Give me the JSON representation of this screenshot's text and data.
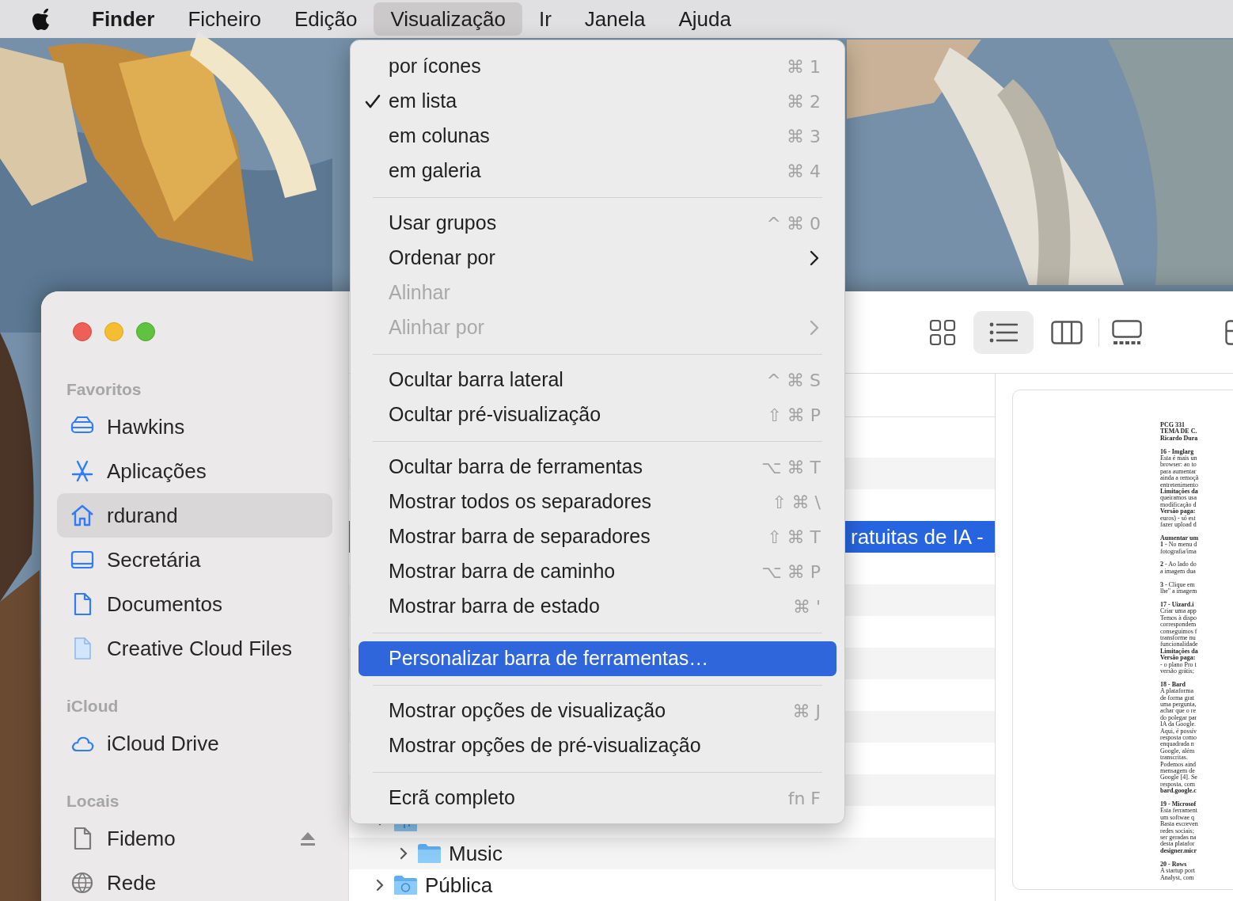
{
  "menu_bar": {
    "items": [
      {
        "label": "Finder",
        "kind": "app",
        "selected": false
      },
      {
        "label": "Ficheiro",
        "kind": "menu",
        "selected": false
      },
      {
        "label": "Edição",
        "kind": "menu",
        "selected": false
      },
      {
        "label": "Visualização",
        "kind": "menu",
        "selected": true
      },
      {
        "label": "Ir",
        "kind": "menu",
        "selected": false
      },
      {
        "label": "Janela",
        "kind": "menu",
        "selected": false
      },
      {
        "label": "Ajuda",
        "kind": "menu",
        "selected": false
      }
    ]
  },
  "view_menu": {
    "items": [
      {
        "kind": "item",
        "label": "por ícones",
        "shortcut": "⌘ 1",
        "checked": false,
        "disabled": false,
        "submenu": false,
        "selected": false
      },
      {
        "kind": "item",
        "label": "em lista",
        "shortcut": "⌘ 2",
        "checked": true,
        "disabled": false,
        "submenu": false,
        "selected": false
      },
      {
        "kind": "item",
        "label": "em colunas",
        "shortcut": "⌘ 3",
        "checked": false,
        "disabled": false,
        "submenu": false,
        "selected": false
      },
      {
        "kind": "item",
        "label": "em galeria",
        "shortcut": "⌘ 4",
        "checked": false,
        "disabled": false,
        "submenu": false,
        "selected": false
      },
      {
        "kind": "separator"
      },
      {
        "kind": "item",
        "label": "Usar grupos",
        "shortcut": "^ ⌘ 0",
        "checked": false,
        "disabled": false,
        "submenu": false,
        "selected": false
      },
      {
        "kind": "item",
        "label": "Ordenar por",
        "checked": false,
        "disabled": false,
        "submenu": true,
        "selected": false
      },
      {
        "kind": "item",
        "label": "Alinhar",
        "checked": false,
        "disabled": true,
        "submenu": false,
        "selected": false
      },
      {
        "kind": "item",
        "label": "Alinhar por",
        "checked": false,
        "disabled": true,
        "submenu": true,
        "selected": false
      },
      {
        "kind": "separator"
      },
      {
        "kind": "item",
        "label": "Ocultar barra lateral",
        "shortcut": "^ ⌘ S",
        "checked": false,
        "disabled": false,
        "submenu": false,
        "selected": false
      },
      {
        "kind": "item",
        "label": "Ocultar pré-visualização",
        "shortcut": "⇧ ⌘ P",
        "checked": false,
        "disabled": false,
        "submenu": false,
        "selected": false
      },
      {
        "kind": "separator"
      },
      {
        "kind": "item",
        "label": "Ocultar barra de ferramentas",
        "shortcut": "⌥ ⌘ T",
        "checked": false,
        "disabled": false,
        "submenu": false,
        "selected": false
      },
      {
        "kind": "item",
        "label": "Mostrar todos os separadores",
        "shortcut": "⇧ ⌘ \\",
        "checked": false,
        "disabled": false,
        "submenu": false,
        "selected": false
      },
      {
        "kind": "item",
        "label": "Mostrar barra de separadores",
        "shortcut": "⇧ ⌘ T",
        "checked": false,
        "disabled": false,
        "submenu": false,
        "selected": false
      },
      {
        "kind": "item",
        "label": "Mostrar barra de caminho",
        "shortcut": "⌥ ⌘ P",
        "checked": false,
        "disabled": false,
        "submenu": false,
        "selected": false
      },
      {
        "kind": "item",
        "label": "Mostrar barra de estado",
        "shortcut": "⌘ '",
        "checked": false,
        "disabled": false,
        "submenu": false,
        "selected": false
      },
      {
        "kind": "separator"
      },
      {
        "kind": "item",
        "label": "Personalizar barra de ferramentas…",
        "checked": false,
        "disabled": false,
        "submenu": false,
        "selected": true
      },
      {
        "kind": "separator"
      },
      {
        "kind": "item",
        "label": "Mostrar opções de visualização",
        "shortcut": "⌘ J",
        "checked": false,
        "disabled": false,
        "submenu": false,
        "selected": false
      },
      {
        "kind": "item",
        "label": "Mostrar opções de pré-visualização",
        "checked": false,
        "disabled": false,
        "submenu": false,
        "selected": false
      },
      {
        "kind": "separator"
      },
      {
        "kind": "item",
        "label": "Ecrã completo",
        "shortcut": "fn F",
        "checked": false,
        "disabled": false,
        "submenu": false,
        "selected": false
      }
    ]
  },
  "sidebar": {
    "sections": [
      {
        "title": "Favoritos",
        "items": [
          {
            "label": "Hawkins",
            "kind": "drive",
            "selected": false,
            "eject": false
          },
          {
            "label": "Aplicações",
            "kind": "apps",
            "selected": false,
            "eject": false
          },
          {
            "label": "rdurand",
            "kind": "home",
            "selected": true,
            "eject": false
          },
          {
            "label": "Secretária",
            "kind": "desktop",
            "selected": false,
            "eject": false
          },
          {
            "label": "Documentos",
            "kind": "doc",
            "selected": false,
            "eject": false
          },
          {
            "label": "Creative Cloud Files",
            "kind": "cloud-doc",
            "selected": false,
            "eject": false
          }
        ]
      },
      {
        "title": "iCloud",
        "items": [
          {
            "label": "iCloud Drive",
            "kind": "cloud",
            "selected": false,
            "eject": false
          }
        ]
      },
      {
        "title": "Locais",
        "items": [
          {
            "label": "Fidemo",
            "kind": "disk-doc",
            "selected": false,
            "eject": true
          },
          {
            "label": "Rede",
            "kind": "globe",
            "selected": false,
            "eject": false
          }
        ]
      }
    ]
  },
  "toolbar": {
    "view_buttons": [
      {
        "kind": "grid",
        "selected": false
      },
      {
        "kind": "list",
        "selected": true
      },
      {
        "kind": "columns",
        "selected": false
      },
      {
        "kind": "gallery",
        "selected": false
      },
      {
        "kind": "panel",
        "selected": false
      }
    ]
  },
  "file_list": {
    "rows": [
      {
        "selected": false
      },
      {
        "selected": false
      },
      {
        "selected": false
      },
      {
        "label": "ratuitas de IA -",
        "selected": true
      },
      {
        "selected": false
      },
      {
        "selected": false
      },
      {
        "selected": false
      },
      {
        "selected": false
      },
      {
        "selected": false
      },
      {
        "selected": false
      },
      {
        "selected": false
      },
      {
        "selected": false
      },
      {
        "kind": "music-folder",
        "expanded": true,
        "selected": false,
        "children": [
          {
            "label": "Music",
            "kind": "folder",
            "expanded": false,
            "selected": false
          }
        ]
      },
      {
        "label": "Pública",
        "kind": "public-folder",
        "expanded": false,
        "selected": false
      }
    ]
  },
  "preview": {
    "paragraphs": [
      {
        "lines": [
          {
            "text": "PCG 331",
            "bold": true
          },
          {
            "text": "TEMA DE C.",
            "bold": true
          },
          {
            "text": "Ricardo Dura",
            "bold": true
          }
        ]
      },
      {
        "lines": [
          {
            "text": "16 - Imglarg",
            "bold": true
          },
          {
            "text": "Esta é mais un",
            "bold": false
          },
          {
            "text": "browser: ao to",
            "bold": false
          },
          {
            "text": "para aumentar",
            "bold": false
          },
          {
            "text": "ainda a remoçã",
            "bold": false
          },
          {
            "text": "entretenimento",
            "bold": false
          },
          {
            "text": "Limitações da",
            "bold": true
          },
          {
            "text": "queiramos usa",
            "bold": false
          },
          {
            "text": "modificação d",
            "bold": false
          },
          {
            "text": "Versão paga:",
            "bold": true
          },
          {
            "text": "euros) - só est",
            "bold": false
          },
          {
            "text": "fazer upload d",
            "bold": false
          }
        ]
      },
      {
        "lines": [
          {
            "text": "Aumentar um",
            "bold": true
          },
          {
            "text": "**1** - No menu d",
            "bold": false
          },
          {
            "text": "fotografia/ima",
            "bold": false
          }
        ]
      },
      {
        "lines": [
          {
            "text": "**2** - Ao lado do",
            "bold": false
          },
          {
            "text": "a imagem dua",
            "bold": false
          }
        ]
      },
      {
        "lines": [
          {
            "text": "**3** - Clique em",
            "bold": false
          },
          {
            "text": "lhe\" a imagem",
            "bold": false
          }
        ]
      },
      {
        "lines": [
          {
            "text": "17 - Uizard.i",
            "bold": true
          },
          {
            "text": "Criar uma app",
            "bold": false
          },
          {
            "text": "Temos à dispo",
            "bold": false
          },
          {
            "text": "correspondem",
            "bold": false
          },
          {
            "text": "conseguimos f",
            "bold": false
          },
          {
            "text": "transforme nu",
            "bold": false
          },
          {
            "text": "funcionalidade",
            "bold": false
          },
          {
            "text": "Limitações da",
            "bold": true
          },
          {
            "text": "Versão paga:",
            "bold": true
          },
          {
            "text": "- o plano Pro t",
            "bold": false
          },
          {
            "text": "versão grátis;",
            "bold": false
          }
        ]
      },
      {
        "lines": [
          {
            "text": "18 - Bard",
            "bold": true
          },
          {
            "text": "A plataforma",
            "bold": false
          },
          {
            "text": "de forma grat",
            "bold": false
          },
          {
            "text": "uma pergunta,",
            "bold": false
          },
          {
            "text": "achar que o re",
            "bold": false
          },
          {
            "text": "do polegar par",
            "bold": false
          },
          {
            "text": "IA da Google.",
            "bold": false
          },
          {
            "text": "Aqui, é possív",
            "bold": false
          },
          {
            "text": "resposta como",
            "bold": false
          },
          {
            "text": "enquadrada n",
            "bold": false
          },
          {
            "text": "Google, além",
            "bold": false
          },
          {
            "text": "transcritas.",
            "bold": false
          },
          {
            "text": "Podemos aind",
            "bold": false
          },
          {
            "text": "mensagem de",
            "bold": false
          },
          {
            "text": "Google [4]. Se",
            "bold": false
          },
          {
            "text": "resposta, com",
            "bold": false
          },
          {
            "text": "bard.google.c",
            "bold": true
          }
        ]
      },
      {
        "lines": [
          {
            "text": "19 - Microsof",
            "bold": true
          },
          {
            "text": "Esta ferrament",
            "bold": false
          },
          {
            "text": "um softwae q",
            "bold": false
          },
          {
            "text": "Basta escreven",
            "bold": false
          },
          {
            "text": "redes sociais;",
            "bold": false
          },
          {
            "text": "ser geradas na",
            "bold": false
          },
          {
            "text": "desta platafor",
            "bold": false
          },
          {
            "text": "designer.micr",
            "bold": true
          }
        ]
      },
      {
        "lines": [
          {
            "text": "20 - Rows",
            "bold": true
          },
          {
            "text": "A startup port",
            "bold": false
          },
          {
            "text": "Analyst, com",
            "bold": false
          }
        ]
      }
    ]
  }
}
